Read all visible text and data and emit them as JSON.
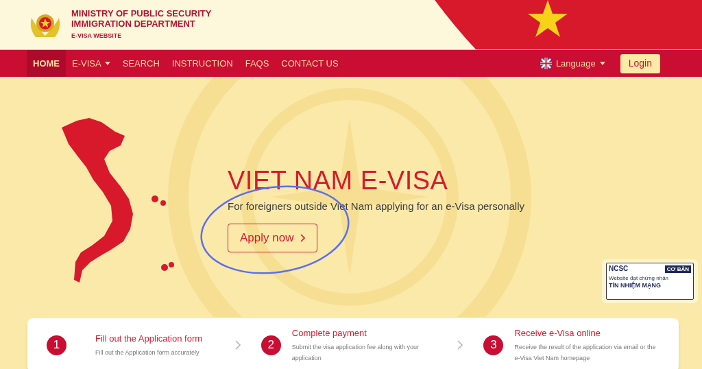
{
  "header": {
    "title_line_1": "MINISTRY OF PUBLIC SECURITY",
    "title_line_2": "IMMIGRATION DEPARTMENT",
    "subtitle": "E-VISA WEBSITE"
  },
  "nav": {
    "items": [
      {
        "label": "HOME",
        "selected": true,
        "dropdown": false
      },
      {
        "label": "E-VISA",
        "selected": false,
        "dropdown": true
      },
      {
        "label": "SEARCH",
        "selected": false,
        "dropdown": false
      },
      {
        "label": "INSTRUCTION",
        "selected": false,
        "dropdown": false
      },
      {
        "label": "FAQS",
        "selected": false,
        "dropdown": false
      },
      {
        "label": "CONTACT US",
        "selected": false,
        "dropdown": false
      }
    ],
    "language": "Language",
    "login": "Login"
  },
  "hero": {
    "title": "VIET NAM E-VISA",
    "subtitle": "For foreigners outside Viet Nam applying for an e-Visa personally",
    "button": "Apply now",
    "highlighted": true
  },
  "badge": {
    "brand": "NCSC",
    "level": "CƠ BẢN",
    "line_1": "Website đạt chứng nhận",
    "line_2": "TÍN NHIỆM MẠNG"
  },
  "steps": [
    {
      "number": "1",
      "title": "Fill out the Application form",
      "description": "Fill out the Application form accurately"
    },
    {
      "number": "2",
      "title": "Complete payment",
      "description": "Submit the visa application fee along with your application"
    },
    {
      "number": "3",
      "title": "Receive e-Visa online",
      "description": "Receive the result of the application via email or the e-Visa Viet Nam homepage"
    }
  ]
}
